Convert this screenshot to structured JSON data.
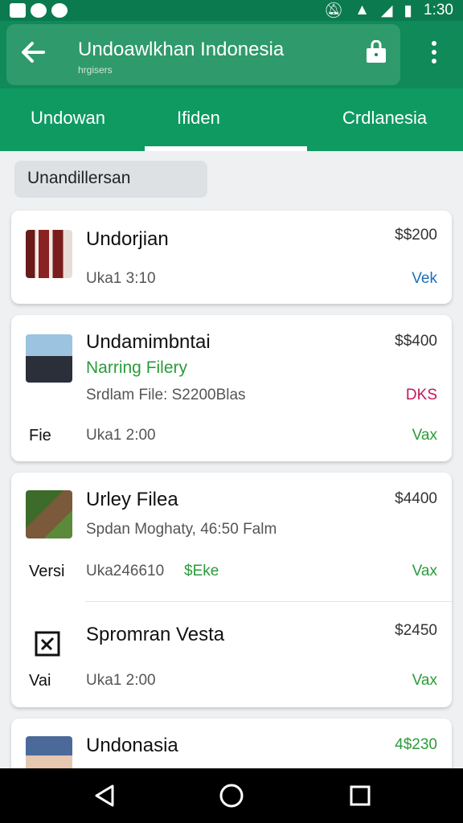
{
  "status": {
    "time": "1:30"
  },
  "appbar": {
    "title": "Undoawlkhan Indonesia",
    "subtitle": "hrgisers"
  },
  "tabs": [
    "Undowan",
    "Ifiden",
    "Crdlanesia"
  ],
  "filter": {
    "label": "Unandillersan"
  },
  "items": [
    {
      "title": "Undorjian",
      "price": "$$200",
      "meta": "Uka1 3:10",
      "tag": "Vek"
    },
    {
      "title": "Undamimbntai",
      "subtitle": "Narring Filery",
      "line3": "Srdlam File: S2200Blas",
      "line3_tag": "DKS",
      "side": "Fie",
      "meta": "Uka1 2:00",
      "price": "$$400",
      "tag": "Vax"
    },
    {
      "title": "Urley Filea",
      "line2": "Spdan Moghaty, 46:50 Falm",
      "side": "Versi",
      "meta": "Uka246610",
      "meta_tag": "$Eke",
      "price": "$4400",
      "tag": "Vax"
    },
    {
      "title": "Spromran Vesta",
      "side": "Vai",
      "meta": "Uka1 2:00",
      "price": "$2450",
      "tag": "Vax"
    },
    {
      "title": "Undonasia",
      "price": "4$230"
    }
  ],
  "colors": {
    "primary": "#0f9a62",
    "accent_green": "#2a9b3a",
    "accent_blue": "#1c6fb8",
    "accent_red": "#c2185b"
  }
}
